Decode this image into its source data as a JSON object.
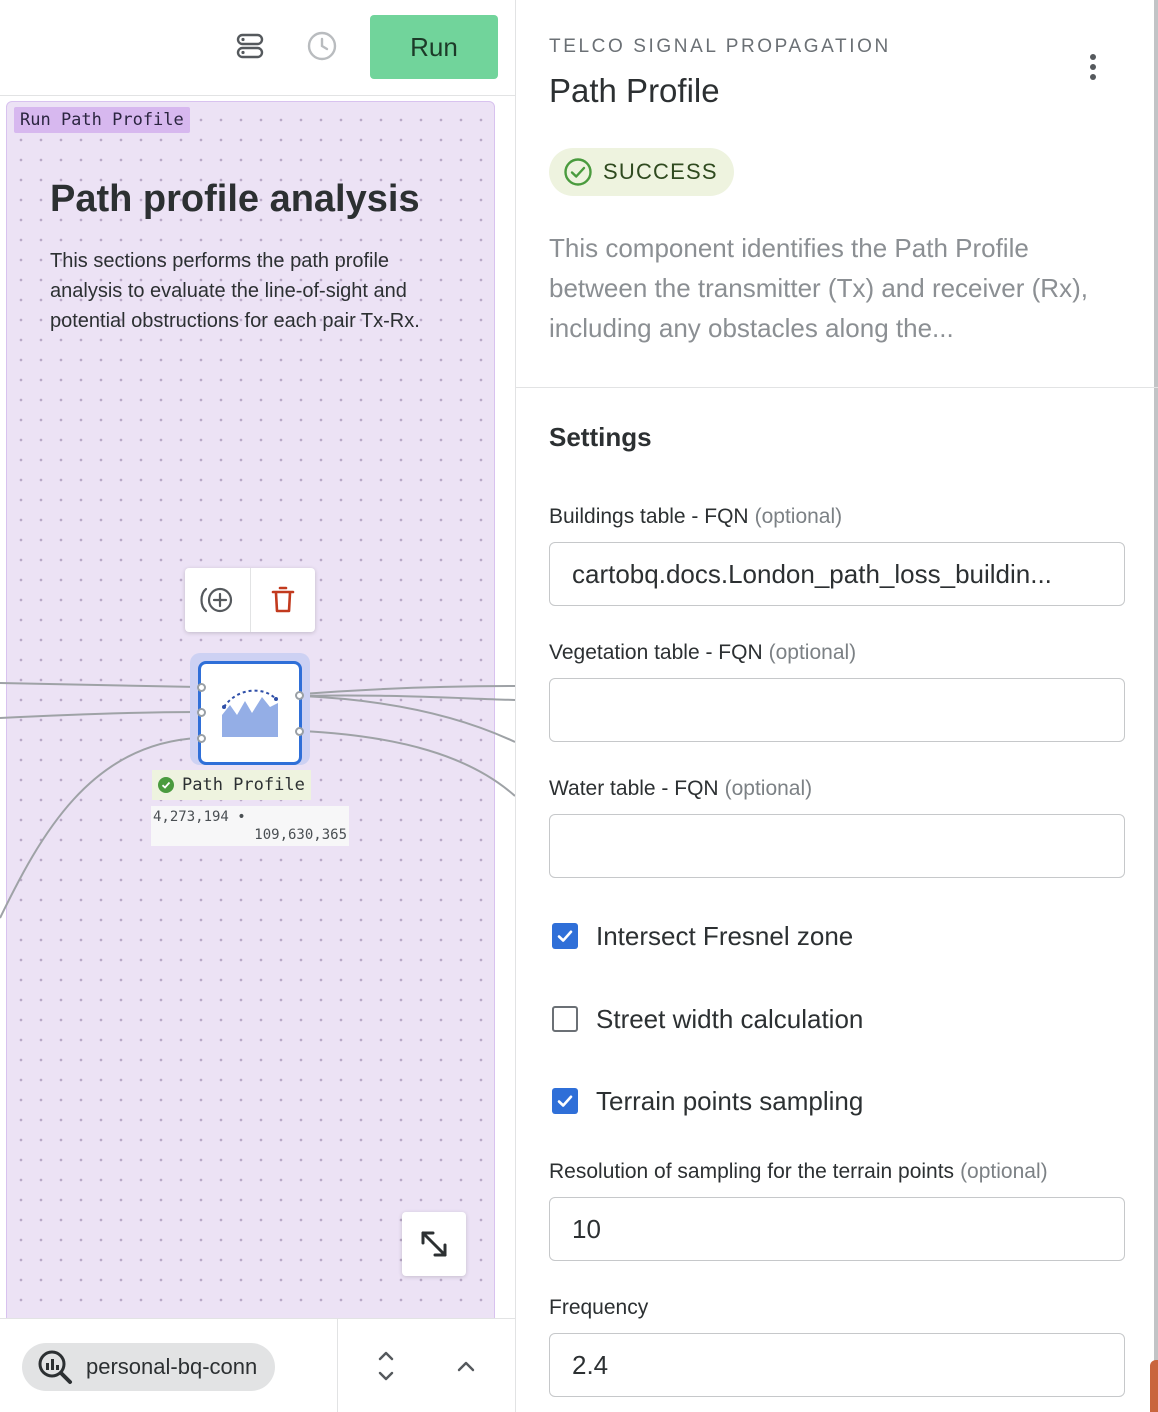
{
  "toolbar": {
    "icons": [
      "layers-toggle-icon",
      "history-clock-icon"
    ],
    "run_label": "Run"
  },
  "canvas": {
    "group_tag": "Run Path Profile",
    "note": {
      "title": "Path profile analysis",
      "text": "This sections performs the path profile analysis to evaluate the line-of-sight and potential obstructions for each pair Tx-Rx."
    },
    "node": {
      "label": "Path Profile",
      "count_in": "4,273,194 •",
      "count_out": "109,630,365",
      "status": "success"
    },
    "node_actions": [
      "add-connected-icon",
      "trash-icon"
    ]
  },
  "bottombar": {
    "connection_name": "personal-bq-conn"
  },
  "panel": {
    "overline": "TELCO SIGNAL PROPAGATION",
    "title": "Path Profile",
    "status": "SUCCESS",
    "description": "This component identifies the Path Profile between the transmitter (Tx) and receiver (Rx), including any obstacles along the...",
    "settings_title": "Settings",
    "optional_text": "(optional)",
    "fields": {
      "buildings": {
        "label": "Buildings table - FQN",
        "value": "cartobq.docs.London_path_loss_buildin..."
      },
      "vegetation": {
        "label": "Vegetation table - FQN",
        "value": ""
      },
      "water": {
        "label": "Water table - FQN",
        "value": ""
      },
      "resolution": {
        "label": "Resolution of sampling for the terrain points",
        "value": "10"
      },
      "frequency": {
        "label": "Frequency",
        "value": "2.4"
      }
    },
    "checkboxes": [
      {
        "label": "Intersect Fresnel zone",
        "checked": true
      },
      {
        "label": "Street width calculation",
        "checked": false
      },
      {
        "label": "Terrain points sampling",
        "checked": true
      }
    ]
  },
  "colors": {
    "run_button": "#71d49b",
    "group_bg": "#ece2f5",
    "group_tag": "#d7b8ef",
    "node_border": "#2f6fd8",
    "success_bg": "#eef3df",
    "success_icon": "#4a9b3e",
    "checkbox_on": "#2f6fd8"
  }
}
